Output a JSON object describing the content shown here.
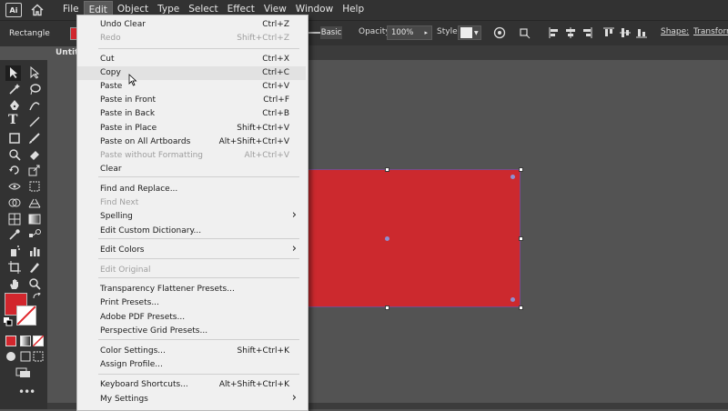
{
  "menubar": {
    "logo_text": "Ai",
    "items": [
      "File",
      "Edit",
      "Object",
      "Type",
      "Select",
      "Effect",
      "View",
      "Window",
      "Help"
    ],
    "active": "Edit"
  },
  "control_bar": {
    "selection_label": "Rectangle",
    "fill_color": "#d2262d",
    "stroke_style": "Basic",
    "opacity_label": "Opacity:",
    "opacity_value": "100%",
    "style_label": "Style:",
    "shape_label": "Shape:",
    "transform_label": "Transform"
  },
  "document_tab": {
    "label": "Untitl"
  },
  "edit_menu": {
    "items": [
      {
        "label": "Undo Clear",
        "shortcut": "Ctrl+Z",
        "enabled": true
      },
      {
        "label": "Redo",
        "shortcut": "Shift+Ctrl+Z",
        "enabled": false
      },
      {
        "label": "Cut",
        "shortcut": "Ctrl+X",
        "enabled": true
      },
      {
        "label": "Copy",
        "shortcut": "Ctrl+C",
        "enabled": true,
        "hovered": true
      },
      {
        "label": "Paste",
        "shortcut": "Ctrl+V",
        "enabled": true
      },
      {
        "label": "Paste in Front",
        "shortcut": "Ctrl+F",
        "enabled": true
      },
      {
        "label": "Paste in Back",
        "shortcut": "Ctrl+B",
        "enabled": true
      },
      {
        "label": "Paste in Place",
        "shortcut": "Shift+Ctrl+V",
        "enabled": true
      },
      {
        "label": "Paste on All Artboards",
        "shortcut": "Alt+Shift+Ctrl+V",
        "enabled": true
      },
      {
        "label": "Paste without Formatting",
        "shortcut": "Alt+Ctrl+V",
        "enabled": false
      },
      {
        "label": "Clear",
        "shortcut": "",
        "enabled": true
      },
      {
        "label": "Find and Replace...",
        "shortcut": "",
        "enabled": true
      },
      {
        "label": "Find Next",
        "shortcut": "",
        "enabled": false
      },
      {
        "label": "Spelling",
        "shortcut": "",
        "enabled": true,
        "submenu": true
      },
      {
        "label": "Edit Custom Dictionary...",
        "shortcut": "",
        "enabled": true
      },
      {
        "label": "Edit Colors",
        "shortcut": "",
        "enabled": true,
        "submenu": true
      },
      {
        "label": "Edit Original",
        "shortcut": "",
        "enabled": false
      },
      {
        "label": "Transparency Flattener Presets...",
        "shortcut": "",
        "enabled": true
      },
      {
        "label": "Print Presets...",
        "shortcut": "",
        "enabled": true
      },
      {
        "label": "Adobe PDF Presets...",
        "shortcut": "",
        "enabled": true
      },
      {
        "label": "Perspective Grid Presets...",
        "shortcut": "",
        "enabled": true
      },
      {
        "label": "Color Settings...",
        "shortcut": "Shift+Ctrl+K",
        "enabled": true
      },
      {
        "label": "Assign Profile...",
        "shortcut": "",
        "enabled": true
      },
      {
        "label": "Keyboard Shortcuts...",
        "shortcut": "Alt+Shift+Ctrl+K",
        "enabled": true
      },
      {
        "label": "My Settings",
        "shortcut": "",
        "enabled": true,
        "submenu": true
      }
    ]
  },
  "toolbar": {
    "fill_color": "#d2262d",
    "tools": [
      "selection-tool",
      "direct-selection-tool",
      "magic-wand-tool",
      "lasso-tool",
      "pen-tool",
      "curvature-tool",
      "type-tool",
      "line-tool",
      "rectangle-tool",
      "paintbrush-tool",
      "shaper-tool",
      "eraser-tool",
      "rotate-tool",
      "scale-tool",
      "width-tool",
      "free-transform-tool",
      "shape-builder-tool",
      "perspective-grid-tool",
      "mesh-tool",
      "gradient-tool",
      "eyedropper-tool",
      "blend-tool",
      "symbol-sprayer-tool",
      "column-graph-tool",
      "artboard-tool",
      "slice-tool",
      "hand-tool",
      "zoom-tool"
    ]
  },
  "canvas": {
    "object_color": "#cc292e"
  }
}
